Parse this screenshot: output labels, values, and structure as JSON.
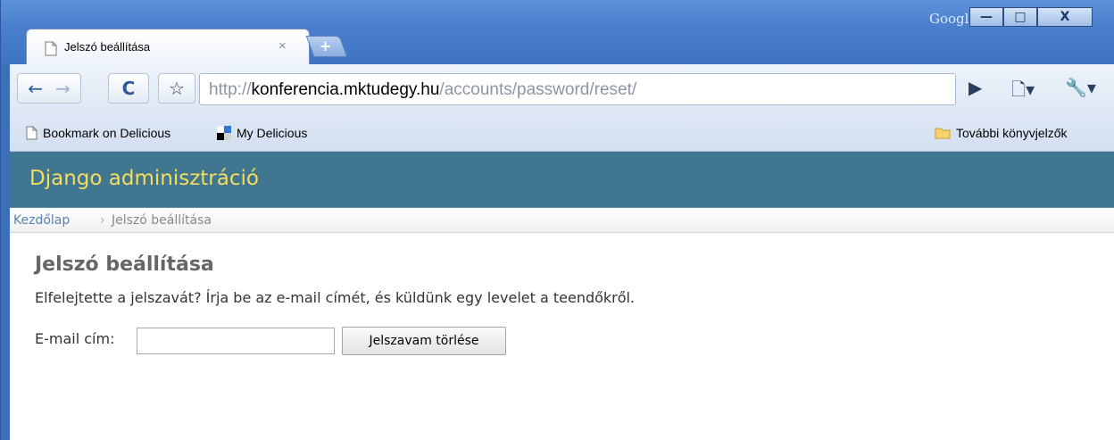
{
  "browser": {
    "google_label": "Google",
    "window_buttons": {
      "minimize": "—",
      "maximize": "□",
      "close": "X"
    },
    "tab": {
      "title": "Jelszó beállítása",
      "close_glyph": "×",
      "new_tab_glyph": "+"
    },
    "toolbar": {
      "back_glyph": "←",
      "forward_glyph": "→",
      "reload_glyph": "C",
      "star_glyph": "☆",
      "url_scheme": "http://",
      "url_domain": "konferencia.mktudegy.hu",
      "url_path": "/accounts/password/reset/",
      "go_glyph": "▶",
      "page_menu_glyph": "🗋▾",
      "tools_menu_glyph": "🔧▾"
    },
    "bookmarks": {
      "items": [
        {
          "label": "Bookmark on Delicious",
          "icon": "page-icon"
        },
        {
          "label": "My Delicious",
          "icon": "delicious-icon"
        }
      ],
      "other_label": "További könyvjelzők"
    }
  },
  "page": {
    "header_title": "Django adminisztráció",
    "breadcrumbs": {
      "home": "Kezdőlap",
      "separator": "›",
      "current": "Jelszó beállítása"
    },
    "title": "Jelszó beállítása",
    "intro": "Elfelejtette a jelszavát? Írja be az e-mail címét, és küldünk egy levelet a teendőkről.",
    "form": {
      "email_label": "E-mail cím:",
      "email_value": "",
      "submit_label": "Jelszavam törlése"
    }
  },
  "colors": {
    "admin_header_bg": "#417690",
    "admin_header_text": "#f5dd5d",
    "link": "#5b80b2",
    "window_frame": "#3d70b7"
  }
}
